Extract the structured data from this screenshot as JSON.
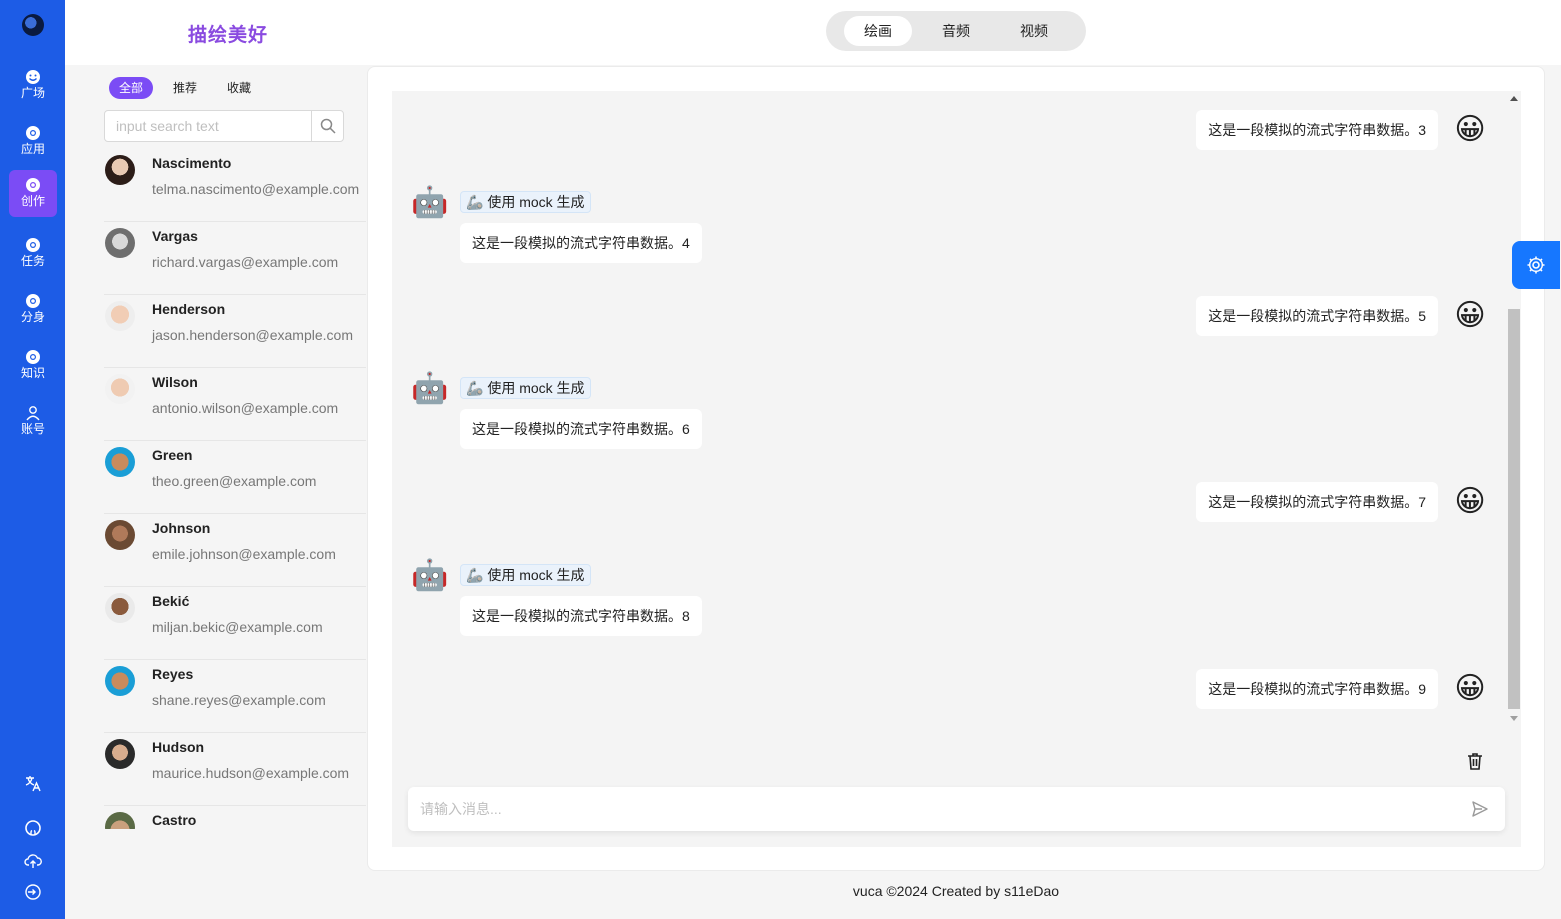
{
  "sidebar": {
    "logo": "globe-logo",
    "items": [
      {
        "label": "广场",
        "icon": "face-icon"
      },
      {
        "label": "应用",
        "icon": "chrome-icon"
      },
      {
        "label": "创作",
        "icon": "chrome-icon",
        "active": true
      },
      {
        "label": "任务",
        "icon": "chrome-icon"
      },
      {
        "label": "分身",
        "icon": "chrome-icon"
      },
      {
        "label": "知识",
        "icon": "chrome-icon"
      },
      {
        "label": "账号",
        "icon": "user-icon"
      }
    ],
    "bottom_icons": [
      "translate-icon",
      "github-icon",
      "cloud-upload-icon",
      "logout-icon"
    ],
    "bg_color": "#1d5ce6",
    "active_color": "#7b4cf5"
  },
  "header": {
    "brand": "描绘美好",
    "tabs": [
      {
        "label": "绘画",
        "active": true
      },
      {
        "label": "音频"
      },
      {
        "label": "视频"
      }
    ]
  },
  "contacts": {
    "filters": [
      {
        "label": "全部",
        "active": true
      },
      {
        "label": "推荐"
      },
      {
        "label": "收藏"
      }
    ],
    "search_placeholder": "input search text",
    "items": [
      {
        "name": "Nascimento",
        "email": "telma.nascimento@example.com"
      },
      {
        "name": "Vargas",
        "email": "richard.vargas@example.com"
      },
      {
        "name": "Henderson",
        "email": "jason.henderson@example.com"
      },
      {
        "name": "Wilson",
        "email": "antonio.wilson@example.com"
      },
      {
        "name": "Green",
        "email": "theo.green@example.com"
      },
      {
        "name": "Johnson",
        "email": "emile.johnson@example.com"
      },
      {
        "name": "Bekić",
        "email": "miljan.bekic@example.com"
      },
      {
        "name": "Reyes",
        "email": "shane.reyes@example.com"
      },
      {
        "name": "Hudson",
        "email": "maurice.hudson@example.com"
      },
      {
        "name": "Castro",
        "email": ""
      }
    ]
  },
  "chat": {
    "messages": [
      {
        "role": "user",
        "text": "这是一段模拟的流式字符串数据。3",
        "avatar": "😀"
      },
      {
        "role": "bot",
        "tag": "🦾 使用 mock 生成",
        "text": "这是一段模拟的流式字符串数据。4",
        "avatar": "🤖"
      },
      {
        "role": "user",
        "text": "这是一段模拟的流式字符串数据。5",
        "avatar": "😀"
      },
      {
        "role": "bot",
        "tag": "🦾 使用 mock 生成",
        "text": "这是一段模拟的流式字符串数据。6",
        "avatar": "🤖"
      },
      {
        "role": "user",
        "text": "这是一段模拟的流式字符串数据。7",
        "avatar": "😀"
      },
      {
        "role": "bot",
        "tag": "🦾 使用 mock 生成",
        "text": "这是一段模拟的流式字符串数据。8",
        "avatar": "🤖"
      },
      {
        "role": "user",
        "text": "这是一段模拟的流式字符串数据。9",
        "avatar": "😀"
      }
    ],
    "input_placeholder": "请输入消息..."
  },
  "footer": "vuca ©2024 Created by s11eDao"
}
